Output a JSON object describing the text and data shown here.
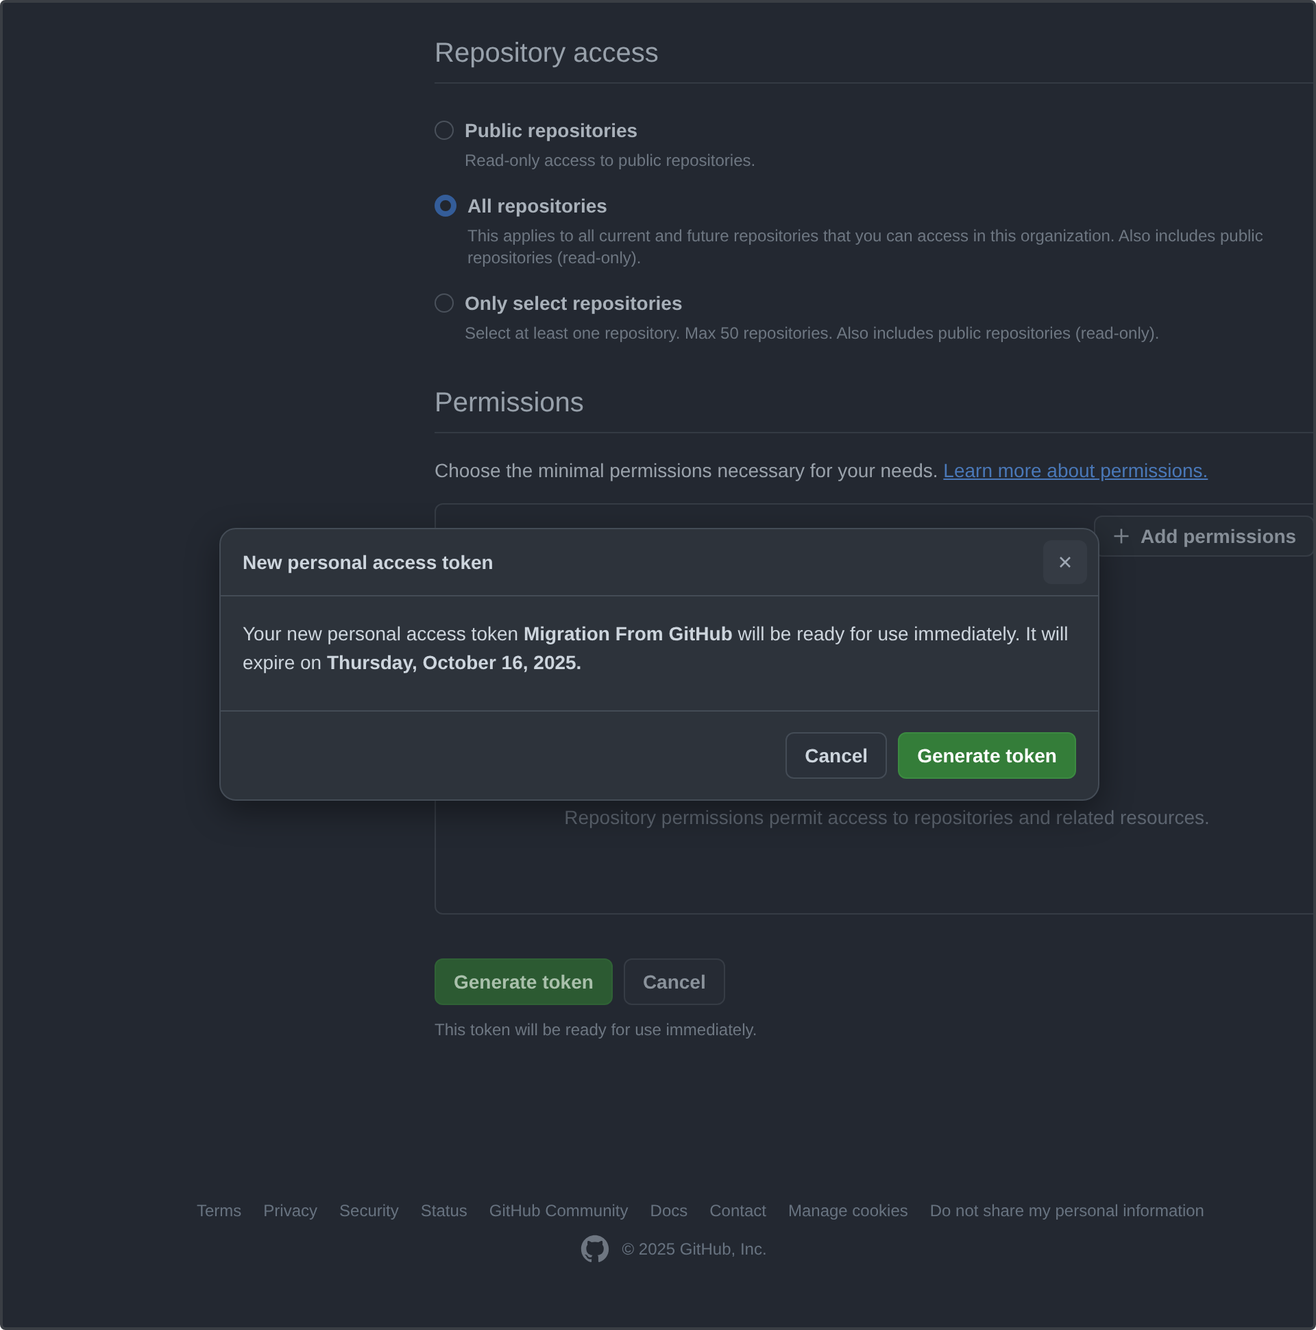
{
  "repository_access": {
    "heading": "Repository access",
    "options": [
      {
        "label": "Public repositories",
        "description": "Read-only access to public repositories.",
        "selected": false
      },
      {
        "label": "All repositories",
        "description": "This applies to all current and future repositories that you can access in this organization. Also includes public repositories (read-only).",
        "selected": true
      },
      {
        "label": "Only select repositories",
        "description": "Select at least one repository. Max 50 repositories. Also includes public repositories (read-only).",
        "selected": false
      }
    ]
  },
  "permissions": {
    "heading": "Permissions",
    "intro": "Choose the minimal permissions necessary for your needs.",
    "link": "Learn more about permissions.",
    "add_button": "Add permissions",
    "empty_text": "Repository permissions permit access to repositories and related resources."
  },
  "actions": {
    "buttons": [
      {
        "label": "Generate token",
        "kind": "primary"
      },
      {
        "label": "Cancel",
        "kind": "secondary"
      }
    ],
    "note": "This token will be ready for use immediately."
  },
  "footer": {
    "links": [
      "Terms",
      "Privacy",
      "Security",
      "Status",
      "GitHub Community",
      "Docs",
      "Contact",
      "Manage cookies",
      "Do not share my personal information"
    ],
    "copyright": "© 2025 GitHub, Inc."
  },
  "dialog": {
    "title": "New personal access token",
    "message": "Your new personal access token **Migration From GitHub** will be ready for use immediately. It will expire on **Thursday, October 16, 2025.**",
    "buttons": [
      {
        "label": "Cancel",
        "kind": "secondary"
      },
      {
        "label": "Generate token",
        "kind": "primary"
      }
    ]
  }
}
